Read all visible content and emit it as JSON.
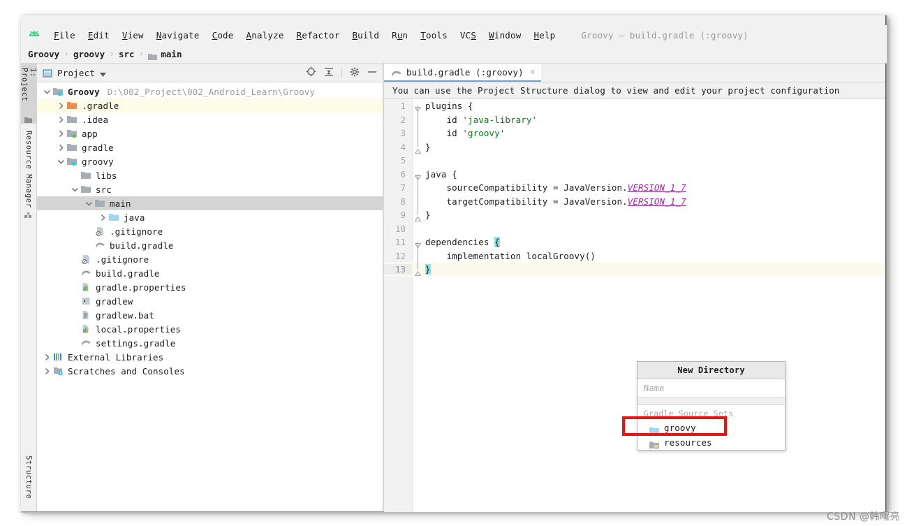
{
  "window": {
    "title": "Groovy – build.gradle (:groovy)",
    "app_icon": "android-studio-icon"
  },
  "menubar": {
    "items": [
      {
        "label": "File",
        "mnemonic": "F"
      },
      {
        "label": "Edit",
        "mnemonic": "E"
      },
      {
        "label": "View",
        "mnemonic": "V"
      },
      {
        "label": "Navigate",
        "mnemonic": "N"
      },
      {
        "label": "Code",
        "mnemonic": "C"
      },
      {
        "label": "Analyze",
        "mnemonic": "A"
      },
      {
        "label": "Refactor",
        "mnemonic": "R"
      },
      {
        "label": "Build",
        "mnemonic": "B"
      },
      {
        "label": "Run",
        "mnemonic": "u"
      },
      {
        "label": "Tools",
        "mnemonic": "T"
      },
      {
        "label": "VCS",
        "mnemonic": "S"
      },
      {
        "label": "Window",
        "mnemonic": "W"
      },
      {
        "label": "Help",
        "mnemonic": "H"
      }
    ]
  },
  "breadcrumb": {
    "items": [
      "Groovy",
      "groovy",
      "src",
      "main"
    ],
    "separator": "›",
    "last_icon": "folder-icon"
  },
  "tool_strip": {
    "tabs": [
      {
        "label": "1: Project",
        "icon": "project-folder-icon",
        "active": true
      },
      {
        "label": "Resource Manager",
        "icon": "resource-manager-icon",
        "active": false
      },
      {
        "label": "Structure",
        "icon": "structure-icon",
        "active": false
      }
    ]
  },
  "project_panel": {
    "title": "Project",
    "dropdown_icon": "chevron-down-icon",
    "panel_icon": "project-view-icon",
    "actions": [
      {
        "name": "locate-icon",
        "glyph": "target"
      },
      {
        "name": "collapse-all-icon",
        "glyph": "collapse"
      },
      {
        "name": "settings-gear-icon",
        "glyph": "gear"
      },
      {
        "name": "minimize-icon",
        "glyph": "minus"
      }
    ],
    "tree": [
      {
        "label": "Groovy",
        "path": "D:\\002_Project\\002_Android_Learn\\Groovy",
        "indent": 0,
        "arrow": "down",
        "icon": "module-folder-icon",
        "bold": true,
        "state": "normal"
      },
      {
        "label": ".gradle",
        "indent": 1,
        "arrow": "right",
        "icon": "excluded-folder-icon",
        "bold": false,
        "state": "highlight"
      },
      {
        "label": ".idea",
        "indent": 1,
        "arrow": "right",
        "icon": "folder-icon",
        "bold": false,
        "state": "normal"
      },
      {
        "label": "app",
        "indent": 1,
        "arrow": "right",
        "icon": "module-android-icon",
        "bold": false,
        "state": "normal"
      },
      {
        "label": "gradle",
        "indent": 1,
        "arrow": "right",
        "icon": "folder-icon",
        "bold": false,
        "state": "normal"
      },
      {
        "label": "groovy",
        "indent": 1,
        "arrow": "down",
        "icon": "module-folder-icon",
        "bold": false,
        "state": "normal"
      },
      {
        "label": "libs",
        "indent": 2,
        "arrow": "none",
        "icon": "folder-icon",
        "bold": false,
        "state": "normal"
      },
      {
        "label": "src",
        "indent": 2,
        "arrow": "down",
        "icon": "folder-icon",
        "bold": false,
        "state": "normal"
      },
      {
        "label": "main",
        "indent": 3,
        "arrow": "down",
        "icon": "folder-icon",
        "bold": false,
        "state": "selected"
      },
      {
        "label": "java",
        "indent": 4,
        "arrow": "right",
        "icon": "source-folder-icon",
        "bold": false,
        "state": "normal"
      },
      {
        "label": ".gitignore",
        "indent": 3,
        "arrow": "none",
        "icon": "gitignore-file-icon",
        "bold": false,
        "state": "normal"
      },
      {
        "label": "build.gradle",
        "indent": 3,
        "arrow": "none",
        "icon": "gradle-file-icon",
        "bold": false,
        "state": "normal"
      },
      {
        "label": ".gitignore",
        "indent": 2,
        "arrow": "none",
        "icon": "gitignore-file-icon",
        "bold": false,
        "state": "normal"
      },
      {
        "label": "build.gradle",
        "indent": 2,
        "arrow": "none",
        "icon": "gradle-file-icon",
        "bold": false,
        "state": "normal"
      },
      {
        "label": "gradle.properties",
        "indent": 2,
        "arrow": "none",
        "icon": "properties-file-icon",
        "bold": false,
        "state": "normal"
      },
      {
        "label": "gradlew",
        "indent": 2,
        "arrow": "none",
        "icon": "shell-script-icon",
        "bold": false,
        "state": "normal"
      },
      {
        "label": "gradlew.bat",
        "indent": 2,
        "arrow": "none",
        "icon": "bat-file-icon",
        "bold": false,
        "state": "normal"
      },
      {
        "label": "local.properties",
        "indent": 2,
        "arrow": "none",
        "icon": "properties-file-icon",
        "bold": false,
        "state": "normal"
      },
      {
        "label": "settings.gradle",
        "indent": 2,
        "arrow": "none",
        "icon": "gradle-file-icon",
        "bold": false,
        "state": "normal"
      },
      {
        "label": "External Libraries",
        "indent": 0,
        "arrow": "right",
        "icon": "external-libraries-icon",
        "bold": false,
        "state": "normal"
      },
      {
        "label": "Scratches and Consoles",
        "indent": 0,
        "arrow": "right",
        "icon": "scratches-icon",
        "bold": false,
        "state": "normal"
      }
    ]
  },
  "editor": {
    "tab": {
      "label": "build.gradle (:groovy)",
      "icon": "gradle-file-icon",
      "close_glyph": "×"
    },
    "notification": "You can use the Project Structure dialog to view and edit your project configuration",
    "lines": [
      {
        "num": "1",
        "fold": "open",
        "text": "plugins {",
        "caret": false
      },
      {
        "num": "2",
        "fold": "bar",
        "text": "    id 'java-library'",
        "caret": false
      },
      {
        "num": "3",
        "fold": "bar",
        "text": "    id 'groovy'",
        "caret": false
      },
      {
        "num": "4",
        "fold": "close",
        "text": "}",
        "caret": false
      },
      {
        "num": "5",
        "fold": "none",
        "text": "",
        "caret": false
      },
      {
        "num": "6",
        "fold": "open",
        "text": "java {",
        "caret": false
      },
      {
        "num": "7",
        "fold": "bar",
        "text": "    sourceCompatibility = JavaVersion.VERSION_1_7",
        "caret": false
      },
      {
        "num": "8",
        "fold": "bar",
        "text": "    targetCompatibility = JavaVersion.VERSION_1_7",
        "caret": false
      },
      {
        "num": "9",
        "fold": "close",
        "text": "}",
        "caret": false
      },
      {
        "num": "10",
        "fold": "none",
        "text": "",
        "caret": false
      },
      {
        "num": "11",
        "fold": "open",
        "text": "dependencies {",
        "caret": false
      },
      {
        "num": "12",
        "fold": "bar",
        "text": "    implementation localGroovy()",
        "caret": false
      },
      {
        "num": "13",
        "fold": "close",
        "text": "}",
        "caret": true
      }
    ]
  },
  "popup": {
    "title": "New Directory",
    "name_placeholder": "Name",
    "group_label": "Gradle Source Sets",
    "items": [
      {
        "label": "groovy",
        "icon": "source-folder-icon",
        "annotated": true
      },
      {
        "label": "resources",
        "icon": "resources-folder-icon",
        "annotated": false
      }
    ]
  },
  "annotation": {
    "color": "#ee1111"
  },
  "watermark": "CSDN @韩曙亮"
}
